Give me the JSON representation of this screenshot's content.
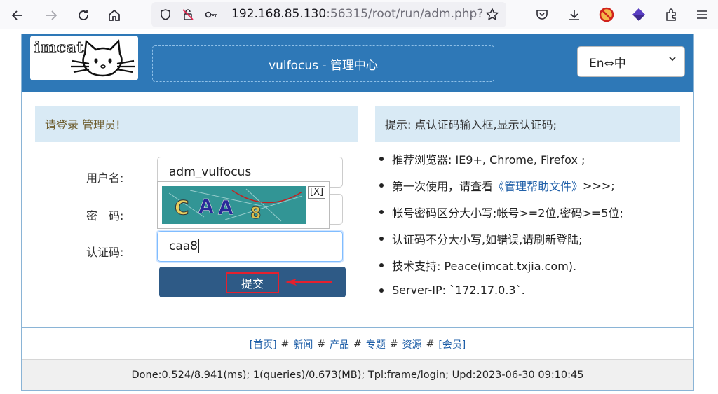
{
  "browser": {
    "url_host": "192.168.85.130",
    "url_rest": ":56315/root/run/adm.php?"
  },
  "header": {
    "logo_text": "imcat",
    "title": "vulfocus - 管理中心",
    "lang_value": "En⇔中"
  },
  "login": {
    "heading": "请登录 管理员!",
    "username_label": "用户名:",
    "username_value": "adm_vulfocus",
    "password_label": "密　码:",
    "captcha_label": "认证码:",
    "captcha_value": "caa8",
    "captcha_image_text": "CAA8",
    "captcha_close": "[X]",
    "submit_label": "提交"
  },
  "tips": {
    "heading": "提示: 点认证码输入框,显示认证码;",
    "items": [
      "推荐浏览器: IE9+, Chrome, Firefox ;",
      "第一次使用，请查看",
      "帐号密码区分大小写;帐号>=2位,密码>=5位;",
      "认证码不分大小写,如错误,请刷新登陆;",
      "技术支持: Peace(imcat.txjia.com).",
      "Server-IP: `172.17.0.3`."
    ],
    "help_link": "《管理帮助文件》",
    "help_suffix": ">>>;"
  },
  "footer": {
    "nav": [
      "[首页]",
      "新闻",
      "产品",
      "专题",
      "资源",
      "[会员]"
    ],
    "separator": "#",
    "status": "Done:0.524/8.941(ms); 1(queries)/0.673(MB); Tpl:frame/login; Upd:2023-06-30 09:10:45"
  },
  "icons": [
    "back-icon",
    "forward-icon",
    "reload-icon",
    "home-icon",
    "shield-icon",
    "permissions-icon",
    "key-icon",
    "bookmark-star-icon",
    "pocket-icon",
    "download-icon",
    "extension-blocked-icon",
    "extension-gem-icon",
    "extensions-icon",
    "menu-icon",
    "chevron-down-icon",
    "cat-logo-icon",
    "arrow-left-icon"
  ],
  "colors": {
    "header_bg": "#2e78b7",
    "panel_bg": "#d9eaf5",
    "button_bg": "#2e5a86",
    "highlight": "#e5202e",
    "link": "#1f5fa8"
  }
}
